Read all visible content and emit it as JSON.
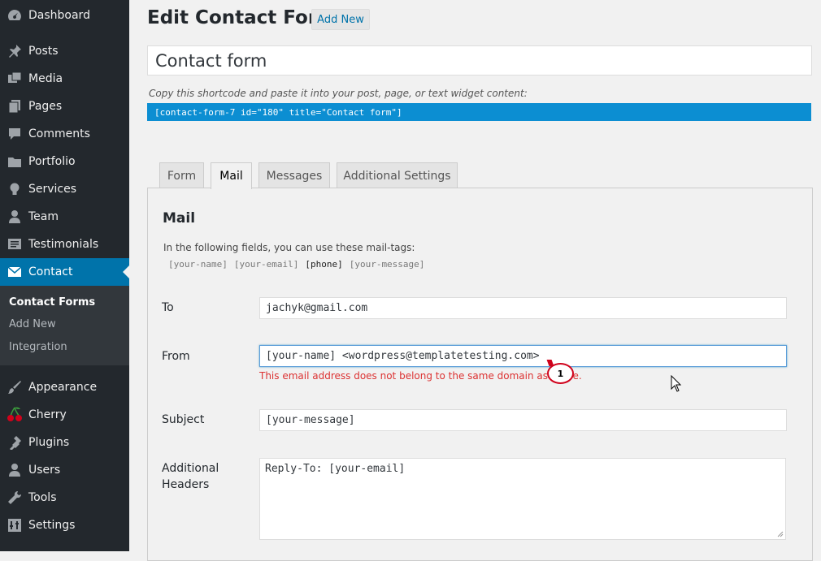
{
  "sidebar": {
    "items": [
      {
        "label": "Dashboard",
        "icon": "dashboard-icon"
      },
      {
        "label": "Posts",
        "icon": "pin-icon"
      },
      {
        "label": "Media",
        "icon": "media-icon"
      },
      {
        "label": "Pages",
        "icon": "pages-icon"
      },
      {
        "label": "Comments",
        "icon": "comment-icon"
      },
      {
        "label": "Portfolio",
        "icon": "folder-icon"
      },
      {
        "label": "Services",
        "icon": "lightbulb-icon"
      },
      {
        "label": "Team",
        "icon": "team-icon"
      },
      {
        "label": "Testimonials",
        "icon": "testimonial-icon"
      },
      {
        "label": "Contact",
        "icon": "mail-icon"
      },
      {
        "label": "Appearance",
        "icon": "brush-icon"
      },
      {
        "label": "Cherry",
        "icon": "cherry-icon"
      },
      {
        "label": "Plugins",
        "icon": "plugin-icon"
      },
      {
        "label": "Users",
        "icon": "user-icon"
      },
      {
        "label": "Tools",
        "icon": "wrench-icon"
      },
      {
        "label": "Settings",
        "icon": "settings-icon"
      }
    ],
    "submenu": [
      "Contact Forms",
      "Add New",
      "Integration"
    ]
  },
  "header": {
    "title": "Edit Contact Form",
    "add_new": "Add New"
  },
  "form": {
    "title_value": "Contact form",
    "shortcode_desc": "Copy this shortcode and paste it into your post, page, or text widget content:",
    "shortcode": "[contact-form-7 id=\"180\" title=\"Contact form\"]"
  },
  "tabs": [
    "Form",
    "Mail",
    "Messages",
    "Additional Settings"
  ],
  "active_tab": "Mail",
  "mail": {
    "heading": "Mail",
    "desc": "In the following fields, you can use these mail-tags:",
    "tags": [
      "[your-name]",
      "[your-email]",
      "[phone]",
      "[your-message]"
    ],
    "to_label": "To",
    "to_value": "jachyk@gmail.com",
    "from_label": "From",
    "from_value": "[your-name] <wordpress@templatetesting.com>",
    "from_error_start": "This email address does not belong to the same domain as t",
    "from_error_end": "e.",
    "subject_label": "Subject",
    "subject_value": "[your-message]",
    "headers_label_1": "Additional",
    "headers_label_2": "Headers",
    "headers_value": "Reply-To: [your-email]"
  },
  "annotation": {
    "callout_number": "1"
  },
  "colors": {
    "accent": "#0073aa",
    "sidebar_bg": "#23282d",
    "shortcode_bg": "#0c8ed2",
    "error": "#dc3232"
  }
}
